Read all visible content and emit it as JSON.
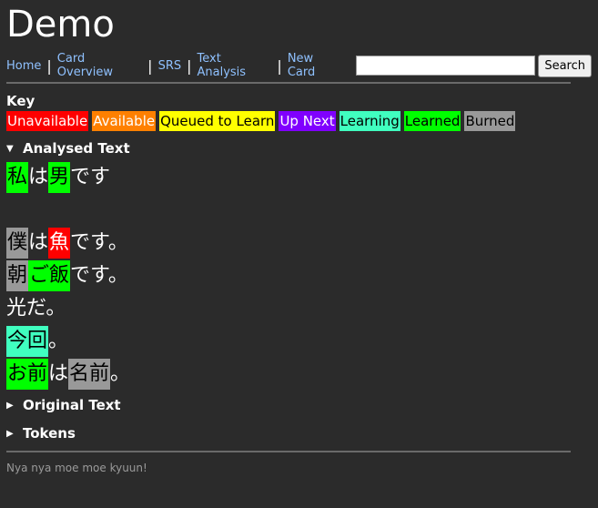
{
  "site": {
    "title": "Demo"
  },
  "nav": {
    "links": [
      "Home",
      "Card Overview",
      "SRS",
      "Text Analysis",
      "New Card"
    ],
    "search_placeholder": "",
    "search_button": "Search"
  },
  "key": {
    "heading": "Key",
    "items": [
      {
        "label": "Unavailable",
        "color": "#ff0000"
      },
      {
        "label": "Available",
        "color": "#ff8000"
      },
      {
        "label": "Queued to Learn",
        "color": "#ffff00"
      },
      {
        "label": "Up Next",
        "color": "#8000ff"
      },
      {
        "label": "Learning",
        "color": "#40ffbf"
      },
      {
        "label": "Learned",
        "color": "#00ff00"
      },
      {
        "label": "Burned",
        "color": "#999999"
      }
    ]
  },
  "sections": {
    "analysed": "Analysed Text",
    "original": "Original Text",
    "tokens": "Tokens"
  },
  "analysed_lines": [
    [
      {
        "t": "私",
        "s": "learned"
      },
      {
        "t": "は"
      },
      {
        "t": "男",
        "s": "learned"
      },
      {
        "t": "です"
      }
    ],
    [],
    [
      {
        "t": "僕",
        "s": "burned"
      },
      {
        "t": "は"
      },
      {
        "t": "魚",
        "s": "unavailable"
      },
      {
        "t": "です。"
      }
    ],
    [
      {
        "t": "朝",
        "s": "burned"
      },
      {
        "t": "ご飯",
        "s": "learned"
      },
      {
        "t": "です。"
      }
    ],
    [
      {
        "t": "光だ。"
      }
    ],
    [
      {
        "t": "今回",
        "s": "learning"
      },
      {
        "t": "。"
      }
    ],
    [
      {
        "t": "お前",
        "s": "learned"
      },
      {
        "t": "は"
      },
      {
        "t": "名前",
        "s": "burned"
      },
      {
        "t": "。"
      }
    ]
  ],
  "footer": {
    "text": "Nya nya moe moe kyuun!"
  }
}
